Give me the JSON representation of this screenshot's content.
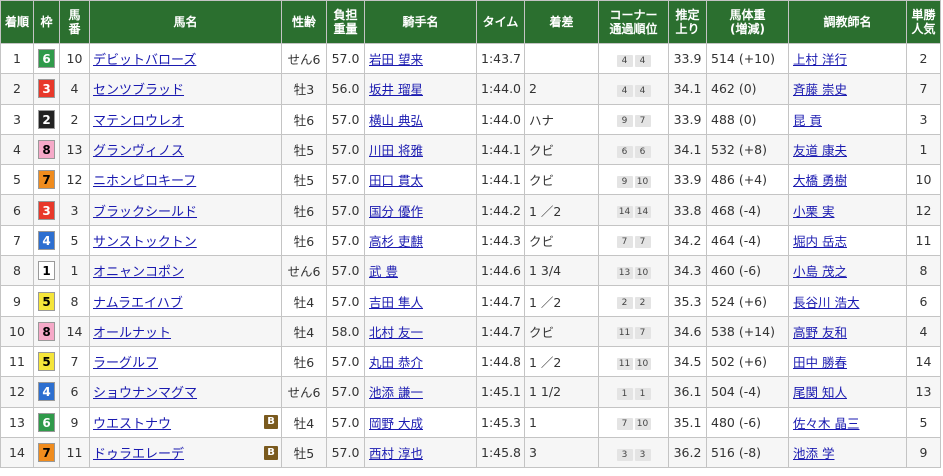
{
  "headers": [
    "着順",
    "枠",
    "馬番",
    "馬名",
    "性齢",
    "負担重量",
    "騎手名",
    "タイム",
    "着差",
    "コーナー通過順位",
    "推定上り",
    "馬体重(増減)",
    "調教師名",
    "単勝人気"
  ],
  "header_lines": [
    [
      "着順"
    ],
    [
      "枠"
    ],
    [
      "馬",
      "番"
    ],
    [
      "馬名"
    ],
    [
      "性齢"
    ],
    [
      "負担",
      "重量"
    ],
    [
      "騎手名"
    ],
    [
      "タイム"
    ],
    [
      "着差"
    ],
    [
      "コーナー",
      "通過順位"
    ],
    [
      "推定",
      "上り"
    ],
    [
      "馬体重",
      "(増減)"
    ],
    [
      "調教師名"
    ],
    [
      "単勝",
      "人気"
    ]
  ],
  "frame_colors": {
    "1": {
      "bg": "#ffffff",
      "fg": "#000000"
    },
    "2": {
      "bg": "#222222",
      "fg": "#ffffff"
    },
    "3": {
      "bg": "#e8382a",
      "fg": "#ffffff"
    },
    "4": {
      "bg": "#2d6fd0",
      "fg": "#ffffff"
    },
    "5": {
      "bg": "#f5e53a",
      "fg": "#000000"
    },
    "6": {
      "bg": "#2f9a4a",
      "fg": "#ffffff"
    },
    "7": {
      "bg": "#f08c1e",
      "fg": "#000000"
    },
    "8": {
      "bg": "#f6a9c8",
      "fg": "#000000"
    }
  },
  "rows": [
    {
      "rank": "1",
      "frame": "6",
      "num": "10",
      "horse": "デビットバローズ",
      "blinker": "",
      "sexage": "せん6",
      "weight": "57.0",
      "jockey": "岩田 望来",
      "time": "1:43.7",
      "margin": "",
      "corner": [
        "4",
        "4"
      ],
      "last3f": "33.9",
      "bodyweight": "514 (+10)",
      "trainer": "上村 洋行",
      "pop": "2"
    },
    {
      "rank": "2",
      "frame": "3",
      "num": "4",
      "horse": "センツブラッド",
      "blinker": "",
      "sexage": "牡3",
      "weight": "56.0",
      "jockey": "坂井 瑠星",
      "time": "1:44.0",
      "margin": "2",
      "corner": [
        "4",
        "4"
      ],
      "last3f": "34.1",
      "bodyweight": "462 (0)",
      "trainer": "斉藤 崇史",
      "pop": "7"
    },
    {
      "rank": "3",
      "frame": "2",
      "num": "2",
      "horse": "マテンロウレオ",
      "blinker": "",
      "sexage": "牡6",
      "weight": "57.0",
      "jockey": "横山 典弘",
      "time": "1:44.0",
      "margin": "ハナ",
      "corner": [
        "9",
        "7"
      ],
      "last3f": "33.9",
      "bodyweight": "488 (0)",
      "trainer": "昆 貢",
      "pop": "3"
    },
    {
      "rank": "4",
      "frame": "8",
      "num": "13",
      "horse": "グランヴィノス",
      "blinker": "",
      "sexage": "牡5",
      "weight": "57.0",
      "jockey": "川田 将雅",
      "time": "1:44.1",
      "margin": "クビ",
      "corner": [
        "6",
        "6"
      ],
      "last3f": "34.1",
      "bodyweight": "532 (+8)",
      "trainer": "友道 康夫",
      "pop": "1"
    },
    {
      "rank": "5",
      "frame": "7",
      "num": "12",
      "horse": "ニホンピロキーフ",
      "blinker": "",
      "sexage": "牡5",
      "weight": "57.0",
      "jockey": "田口 貫太",
      "time": "1:44.1",
      "margin": "クビ",
      "corner": [
        "9",
        "10"
      ],
      "last3f": "33.9",
      "bodyweight": "486 (+4)",
      "trainer": "大橋 勇樹",
      "pop": "10"
    },
    {
      "rank": "6",
      "frame": "3",
      "num": "3",
      "horse": "ブラックシールド",
      "blinker": "",
      "sexage": "牡6",
      "weight": "57.0",
      "jockey": "国分 優作",
      "time": "1:44.2",
      "margin": "1 ／2",
      "corner": [
        "14",
        "14"
      ],
      "last3f": "33.8",
      "bodyweight": "468 (-4)",
      "trainer": "小栗 実",
      "pop": "12"
    },
    {
      "rank": "7",
      "frame": "4",
      "num": "5",
      "horse": "サンストックトン",
      "blinker": "",
      "sexage": "牡6",
      "weight": "57.0",
      "jockey": "高杉 吏麒",
      "time": "1:44.3",
      "margin": "クビ",
      "corner": [
        "7",
        "7"
      ],
      "last3f": "34.2",
      "bodyweight": "464 (-4)",
      "trainer": "堀内 岳志",
      "pop": "11"
    },
    {
      "rank": "8",
      "frame": "1",
      "num": "1",
      "horse": "オニャンコポン",
      "blinker": "",
      "sexage": "せん6",
      "weight": "57.0",
      "jockey": "武 豊",
      "time": "1:44.6",
      "margin": "1 3/4",
      "corner": [
        "13",
        "10"
      ],
      "last3f": "34.3",
      "bodyweight": "460 (-6)",
      "trainer": "小島 茂之",
      "pop": "8"
    },
    {
      "rank": "9",
      "frame": "5",
      "num": "8",
      "horse": "ナムラエイハブ",
      "blinker": "",
      "sexage": "牡4",
      "weight": "57.0",
      "jockey": "吉田 隼人",
      "time": "1:44.7",
      "margin": "1 ／2",
      "corner": [
        "2",
        "2"
      ],
      "last3f": "35.3",
      "bodyweight": "524 (+6)",
      "trainer": "長谷川 浩大",
      "pop": "6"
    },
    {
      "rank": "10",
      "frame": "8",
      "num": "14",
      "horse": "オールナット",
      "blinker": "",
      "sexage": "牡4",
      "weight": "58.0",
      "jockey": "北村 友一",
      "time": "1:44.7",
      "margin": "クビ",
      "corner": [
        "11",
        "7"
      ],
      "last3f": "34.6",
      "bodyweight": "538 (+14)",
      "trainer": "高野 友和",
      "pop": "4"
    },
    {
      "rank": "11",
      "frame": "5",
      "num": "7",
      "horse": "ラーグルフ",
      "blinker": "",
      "sexage": "牡6",
      "weight": "57.0",
      "jockey": "丸田 恭介",
      "time": "1:44.8",
      "margin": "1 ／2",
      "corner": [
        "11",
        "10"
      ],
      "last3f": "34.5",
      "bodyweight": "502 (+6)",
      "trainer": "田中 勝春",
      "pop": "14"
    },
    {
      "rank": "12",
      "frame": "4",
      "num": "6",
      "horse": "ショウナンマグマ",
      "blinker": "",
      "sexage": "せん6",
      "weight": "57.0",
      "jockey": "池添 謙一",
      "time": "1:45.1",
      "margin": "1 1/2",
      "corner": [
        "1",
        "1"
      ],
      "last3f": "36.1",
      "bodyweight": "504 (-4)",
      "trainer": "尾関 知人",
      "pop": "13"
    },
    {
      "rank": "13",
      "frame": "6",
      "num": "9",
      "horse": "ウエストナウ",
      "blinker": "B",
      "sexage": "牡4",
      "weight": "57.0",
      "jockey": "岡野 大成",
      "time": "1:45.3",
      "margin": "1",
      "corner": [
        "7",
        "10"
      ],
      "last3f": "35.1",
      "bodyweight": "480 (-6)",
      "trainer": "佐々木 晶三",
      "pop": "5"
    },
    {
      "rank": "14",
      "frame": "7",
      "num": "11",
      "horse": "ドゥラエレーデ",
      "blinker": "B",
      "sexage": "牡5",
      "weight": "57.0",
      "jockey": "西村 淳也",
      "time": "1:45.8",
      "margin": "3",
      "corner": [
        "3",
        "3"
      ],
      "last3f": "36.2",
      "bodyweight": "516 (-8)",
      "trainer": "池添 学",
      "pop": "9"
    }
  ]
}
